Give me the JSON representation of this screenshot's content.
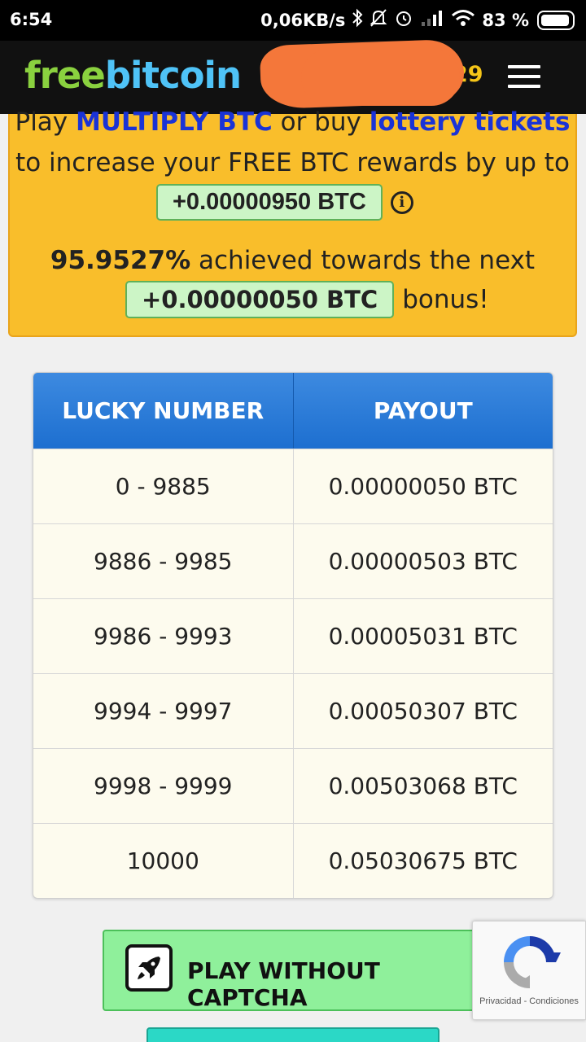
{
  "status_bar": {
    "time": "6:54",
    "network_speed": "0,06KB/s",
    "battery_percent": "83 %",
    "icons": [
      "bluetooth-icon",
      "mute-notifications-icon",
      "alarm-icon",
      "signal-icon",
      "wifi-icon",
      "battery-icon"
    ]
  },
  "header": {
    "logo_part1": "free",
    "logo_part2": "bitcoin",
    "balance_visible": "29",
    "menu_icon": "hamburger-menu-icon",
    "colors": {
      "logo_green": "#8ad13f",
      "logo_blue": "#4fc3f7",
      "balance": "#f5c518"
    }
  },
  "promo": {
    "line1_prefix": "Play ",
    "line1_link1": "MULTIPLY BTC",
    "line1_middle": " or buy ",
    "line1_link2": "lottery tickets",
    "line2": "to increase your FREE BTC rewards by up to",
    "reward_amount": "+0.00000950 BTC",
    "percent": "95.9527%",
    "percent_text": " achieved towards the next",
    "bonus_amount": "+0.00000050 BTC",
    "bonus_suffix": "bonus!"
  },
  "payout_table": {
    "headers": [
      "LUCKY NUMBER",
      "PAYOUT"
    ],
    "rows": [
      [
        "0 - 9885",
        "0.00000050 BTC"
      ],
      [
        "9886 - 9985",
        "0.00000503 BTC"
      ],
      [
        "9986 - 9993",
        "0.00005031 BTC"
      ],
      [
        "9994 - 9997",
        "0.00050307 BTC"
      ],
      [
        "9998 - 9999",
        "0.00503068 BTC"
      ],
      [
        "10000",
        "0.05030675 BTC"
      ]
    ]
  },
  "play_button": {
    "label": "PLAY WITHOUT CAPTCHA",
    "icon": "rocket-icon"
  },
  "recaptcha": {
    "links": "Privacidad - Condiciones"
  }
}
